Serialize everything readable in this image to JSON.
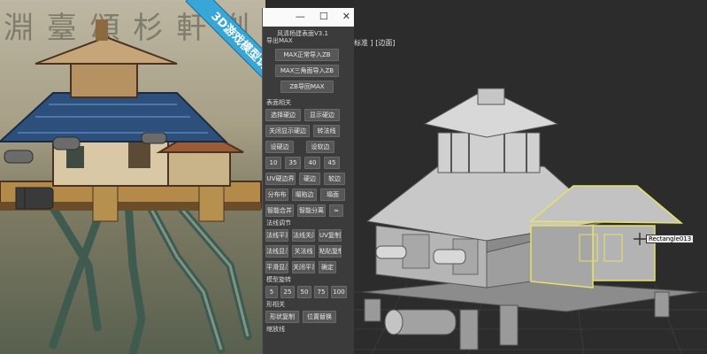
{
  "art": {
    "calligraphy": "淵 臺 頌 杉 軒 剃",
    "ribbon": "3D游戏模型说"
  },
  "window": {
    "close_glyph": "✕",
    "max_glyph": "☐",
    "min_glyph": "—"
  },
  "panel": {
    "title": "风清杨建表面V3.1",
    "section_max": "导出MAX",
    "btn_max_to_zb": "MAX正常导入ZB",
    "btn_max_tri_to_zb": "MAX三角面导入ZB",
    "btn_zb_to_max": "ZB导回MAX",
    "section_surface": "表面相关",
    "btn_select_hard": "选择硬边",
    "btn_show_hard": "显示硬边",
    "btn_hide_hard": "关闭显示硬边",
    "btn_convert": "转法线",
    "btn_set_hard": "设硬边",
    "btn_set_soft": "设软边",
    "angles": [
      "10",
      "35",
      "40",
      "45"
    ],
    "btn_uv_hard": "UV硬边界",
    "btn_hard": "硬边",
    "btn_soft": "软边",
    "btn_distribute": "分布布",
    "btn_collapse_edge": "塌陷边",
    "btn_collapse_face": "塌面",
    "btn_smart_merge": "智能合并",
    "btn_smart_split": "智能分离",
    "btn_extra": "≈",
    "section_normal": "法线调节",
    "btn_normal_smooth": "法线平滑",
    "btn_normal_close": "法线关闭",
    "btn_uv_copy": "UV复制",
    "btn_normal_show": "法线显示",
    "btn_normal_off": "关法线",
    "btn_uv_paste": "粘贴复制",
    "btn_smooth_show": "平滑显示",
    "btn_smooth_close": "关闭平滑",
    "btn_confirm": "确定",
    "section_spin": "模型旋转",
    "spin_values": [
      "5",
      "25",
      "50",
      "75",
      "100"
    ],
    "section_shape": "形相关",
    "btn_shape_copy": "形状复制",
    "btn_shape_replace": "位置替换",
    "section_misc": "缩放线"
  },
  "viewport": {
    "label": "标准 ] [边面]",
    "selection_tag": "Rectangle013"
  }
}
